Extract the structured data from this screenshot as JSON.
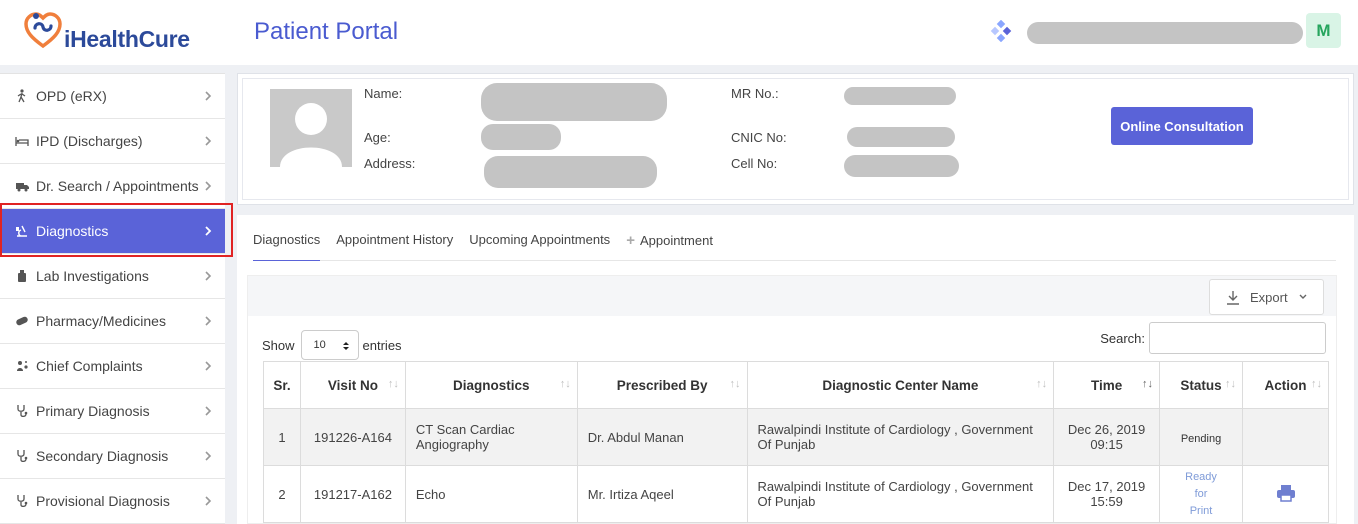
{
  "header": {
    "brand": "iHealthCure",
    "portal_title": "Patient Portal",
    "user_initial": "M"
  },
  "sidebar": {
    "items": [
      {
        "label": "OPD (eRX)",
        "icon": "walking-person-icon"
      },
      {
        "label": "IPD (Discharges)",
        "icon": "hospital-bed-icon"
      },
      {
        "label": "Dr. Search / Appointments",
        "icon": "ambulance-icon"
      },
      {
        "label": "Diagnostics",
        "icon": "microscope-icon"
      },
      {
        "label": "Lab Investigations",
        "icon": "lab-bottle-icon"
      },
      {
        "label": "Pharmacy/Medicines",
        "icon": "pill-icon"
      },
      {
        "label": "Chief Complaints",
        "icon": "complaints-icon"
      },
      {
        "label": "Primary Diagnosis",
        "icon": "stethoscope-icon"
      },
      {
        "label": "Secondary Diagnosis",
        "icon": "stethoscope-icon"
      },
      {
        "label": "Provisional Diagnosis",
        "icon": "stethoscope-icon"
      }
    ],
    "active_index": 3
  },
  "patient": {
    "name_label": "Name:",
    "age_label": "Age:",
    "address_label": "Address:",
    "mr_label": "MR No.:",
    "cnic_label": "CNIC No:",
    "cell_label": "Cell No:",
    "consult_button": "Online Consultation"
  },
  "tabs": {
    "diagnostics": "Diagnostics",
    "history": "Appointment History",
    "upcoming": "Upcoming Appointments",
    "appointment": "Appointment"
  },
  "table": {
    "export_label": "Export",
    "show_label": "Show",
    "entries_value": "10",
    "entries_label": "entries",
    "search_label": "Search:",
    "columns": [
      "Sr.",
      "Visit No",
      "Diagnostics",
      "Prescribed By",
      "Diagnostic Center Name",
      "Time",
      "Status",
      "Action"
    ],
    "rows": [
      {
        "sr": "1",
        "visit_no": "191226-A164",
        "diagnostics": "CT Scan Cardiac Angiography",
        "prescribed_by": "Dr. Abdul Manan",
        "center": "Rawalpindi Institute of Cardiology , Government Of Punjab",
        "time_date": "Dec 26, 2019",
        "time_hour": "09:15",
        "status": "Pending"
      },
      {
        "sr": "2",
        "visit_no": "191217-A162",
        "diagnostics": "Echo",
        "prescribed_by": "Mr. Irtiza Aqeel",
        "center": "Rawalpindi Institute of Cardiology , Government Of Punjab",
        "time_date": "Dec 17, 2019",
        "time_hour": "15:59",
        "status_line1": "Ready",
        "status_line2": "for",
        "status_line3": "Print",
        "action_icon": "print-icon"
      }
    ]
  },
  "colors": {
    "primary": "#5a63d8",
    "brand_blue": "#2c4a9a",
    "brand_orange": "#f07f3c",
    "active_outline": "#e02323",
    "ready_status": "#7f9bd8"
  }
}
